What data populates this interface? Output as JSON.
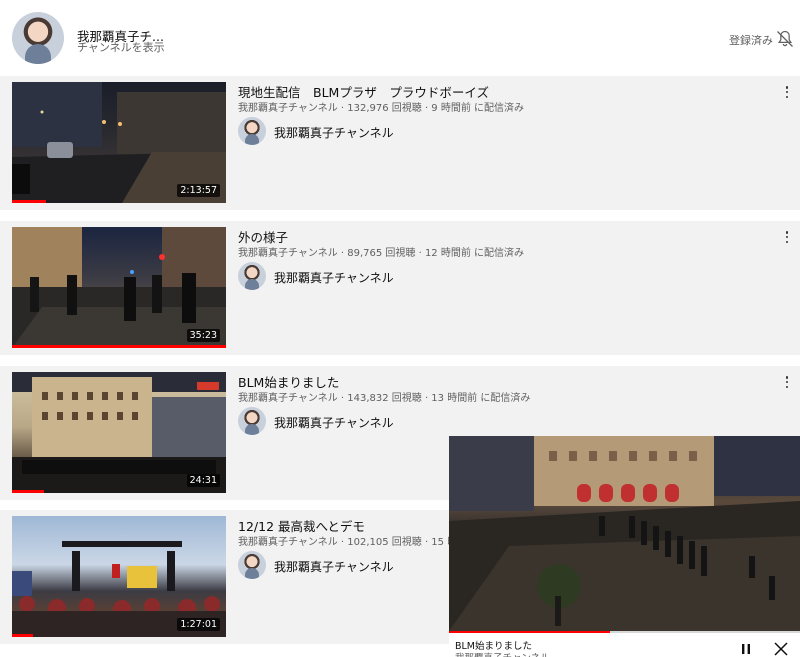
{
  "header": {
    "channel_name": "我那覇真子チ...",
    "channel_sub": "チャンネルを表示",
    "subscribed_label": "登録済み",
    "bell_icon": "bell-off-icon"
  },
  "videos": [
    {
      "title": "現地生配信　BLMプラザ　プラウドボーイズ",
      "meta": "我那覇真子チャンネル · 132,976 回視聴 · 9 時間前 に配信済み",
      "channel": "我那覇真子チャンネル",
      "duration": "2:13:57",
      "watched_fraction": 0.16
    },
    {
      "title": "外の様子",
      "meta": "我那覇真子チャンネル · 89,765 回視聴 · 12 時間前 に配信済み",
      "channel": "我那覇真子チャンネル",
      "duration": "35:23",
      "watched_fraction": 1.0
    },
    {
      "title": "BLM始まりました",
      "meta": "我那覇真子チャンネル · 143,832 回視聴 · 13 時間前 に配信済み",
      "channel": "我那覇真子チャンネル",
      "duration": "24:31",
      "watched_fraction": 0.15
    },
    {
      "title": "12/12 最高裁へとデモ",
      "meta": "我那覇真子チャンネル · 102,105 回視聴 · 15 時",
      "channel": "我那覇真子チャンネル",
      "duration": "1:27:01",
      "watched_fraction": 0.1
    }
  ],
  "miniplayer": {
    "title": "BLM始まりました",
    "channel": "我那覇真子チャンネル",
    "progress_fraction": 0.46,
    "pause_icon": "pause-icon",
    "close_icon": "close-icon"
  },
  "colors": {
    "accent": "#ff0000",
    "item_bg": "#f2f2f2",
    "secondary_text": "#606060"
  }
}
